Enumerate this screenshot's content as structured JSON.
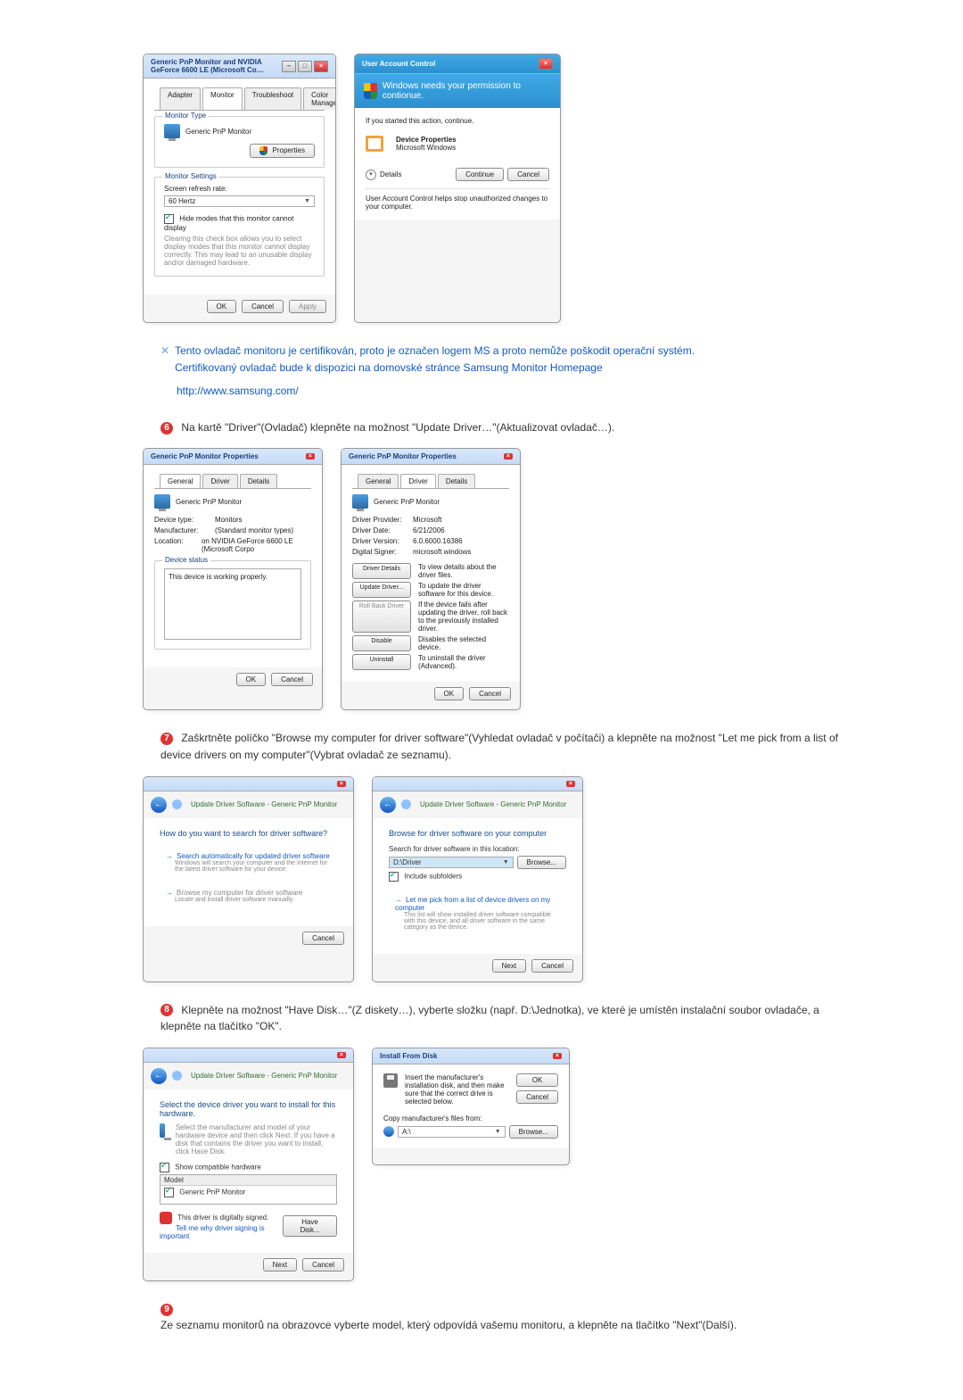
{
  "dialog1": {
    "title": "Generic PnP Monitor and NVIDIA GeForce 6600 LE (Microsoft Co…",
    "tabs": [
      "Adapter",
      "Monitor",
      "Troubleshoot",
      "Color Management"
    ],
    "monitor_type_label": "Monitor Type",
    "monitor_type_value": "Generic PnP Monitor",
    "properties_btn": "Properties",
    "monitor_settings_label": "Monitor Settings",
    "refresh_label": "Screen refresh rate:",
    "refresh_value": "60 Hertz",
    "hide_modes_label": "Hide modes that this monitor cannot display",
    "hide_modes_note": "Clearing this check box allows you to select display modes that this monitor cannot display correctly. This may lead to an unusable display and/or damaged hardware.",
    "ok": "OK",
    "cancel": "Cancel",
    "apply": "Apply"
  },
  "uac": {
    "title": "User Account Control",
    "headline": "Windows needs your permission to contionue.",
    "started": "If you started this action, continue.",
    "dev_name": "Device Properties",
    "dev_vendor": "Microsoft Windows",
    "details": "Details",
    "continue": "Continue",
    "cancel": "Cancel",
    "footer": "User Account Control helps stop unauthorized changes to your computer."
  },
  "note": {
    "line1": "Tento ovladač monitoru je certifikován, proto je označen logem MS a proto nemůže poškodit operační systém.",
    "line2": "Certifikovaný ovladač bude k dispozici na domovské stránce Samsung Monitor Homepage",
    "url": "http://www.samsung.com/"
  },
  "step6": {
    "num": "6",
    "text": "Na kartě \"Driver\"(Ovladač) klepněte na možnost \"Update Driver…\"(Aktualizovat ovladač…)."
  },
  "props_general": {
    "title": "Generic PnP Monitor Properties",
    "tabs": [
      "General",
      "Driver",
      "Details"
    ],
    "name": "Generic PnP Monitor",
    "device_type_lbl": "Device type:",
    "device_type": "Monitors",
    "manufacturer_lbl": "Manufacturer:",
    "manufacturer": "(Standard monitor types)",
    "location_lbl": "Location:",
    "location": "on NVIDIA GeForce 6600 LE (Microsoft Corpo",
    "device_status_lbl": "Device status",
    "status_text": "This device is working properly.",
    "ok": "OK",
    "cancel": "Cancel"
  },
  "props_driver": {
    "title": "Generic PnP Monitor Properties",
    "tabs": [
      "General",
      "Driver",
      "Details"
    ],
    "name": "Generic PnP Monitor",
    "provider_lbl": "Driver Provider:",
    "provider": "Microsoft",
    "date_lbl": "Driver Date:",
    "date": "6/21/2006",
    "version_lbl": "Driver Version:",
    "version": "6.0.6000.16386",
    "signer_lbl": "Digital Signer:",
    "signer": "microsoft windows",
    "btn_details": "Driver Details",
    "btn_details_desc": "To view details about the driver files.",
    "btn_update": "Update Driver...",
    "btn_update_desc": "To update the driver software for this device.",
    "btn_rollback": "Roll Back Driver",
    "btn_rollback_desc": "If the device fails after updating the driver, roll back to the previously installed driver.",
    "btn_disable": "Disable",
    "btn_disable_desc": "Disables the selected device.",
    "btn_uninstall": "Uninstall",
    "btn_uninstall_desc": "To uninstall the driver (Advanced).",
    "ok": "OK",
    "cancel": "Cancel"
  },
  "step7": {
    "num": "7",
    "text": "Zaškrtněte políčko \"Browse my computer for driver software\"(Vyhledat ovladač v počítači) a klepněte na možnost \"Let me pick from a list of device drivers on my computer\"(Vybrat ovladač ze seznamu)."
  },
  "wizard1": {
    "breadcrumb": "Update Driver Software - Generic PnP Monitor",
    "question": "How do you want to search for driver software?",
    "opt1_title": "Search automatically for updated driver software",
    "opt1_sub": "Windows will search your computer and the Internet for the latest driver software for your device.",
    "opt2_title": "Browse my computer for driver software",
    "opt2_sub": "Locate and install driver software manually.",
    "cancel": "Cancel"
  },
  "wizard2": {
    "breadcrumb": "Update Driver Software - Generic PnP Monitor",
    "heading": "Browse for driver software on your computer",
    "path_lbl": "Search for driver software in this location:",
    "path_value": "D:\\Driver",
    "browse": "Browse...",
    "include_sub": "Include subfolders",
    "let_me_pick": "Let me pick from a list of device drivers on my computer",
    "let_me_sub": "This list will show installed driver software compatible with this device, and all driver software in the same category as the device.",
    "next": "Next",
    "cancel": "Cancel"
  },
  "step8": {
    "num": "8",
    "text": "Klepněte na možnost \"Have Disk…\"(Z diskety…), vyberte složku (např. D:\\Jednotka), ve které je umístěn instalační soubor ovladače, a klepněte na tlačítko \"OK\"."
  },
  "wizard3": {
    "breadcrumb": "Update Driver Software - Generic PnP Monitor",
    "heading": "Select the device driver you want to install for this hardware.",
    "sub": "Select the manufacturer and model of your hardware device and then click Next. If you have a disk that contains the driver you want to install, click Have Disk.",
    "show_compatible": "Show compatible hardware",
    "model_lbl": "Model",
    "model_item": "Generic PnP Monitor",
    "sig_line": "This driver is digitally signed.",
    "sig_link": "Tell me why driver signing is important",
    "have_disk": "Have Disk...",
    "next": "Next",
    "cancel": "Cancel"
  },
  "install_disk": {
    "title": "Install From Disk",
    "instr": "Insert the manufacturer's installation disk, and then make sure that the correct drive is selected below.",
    "ok": "OK",
    "cancel": "Cancel",
    "copy_lbl": "Copy manufacturer's files from:",
    "path_value": "A:\\",
    "browse": "Browse..."
  },
  "step9": {
    "num": "9",
    "text": "Ze seznamu monitorů na obrazovce vyberte model, který odpovídá vašemu monitoru, a klepněte na tlačítko \"Next\"(Další)."
  }
}
